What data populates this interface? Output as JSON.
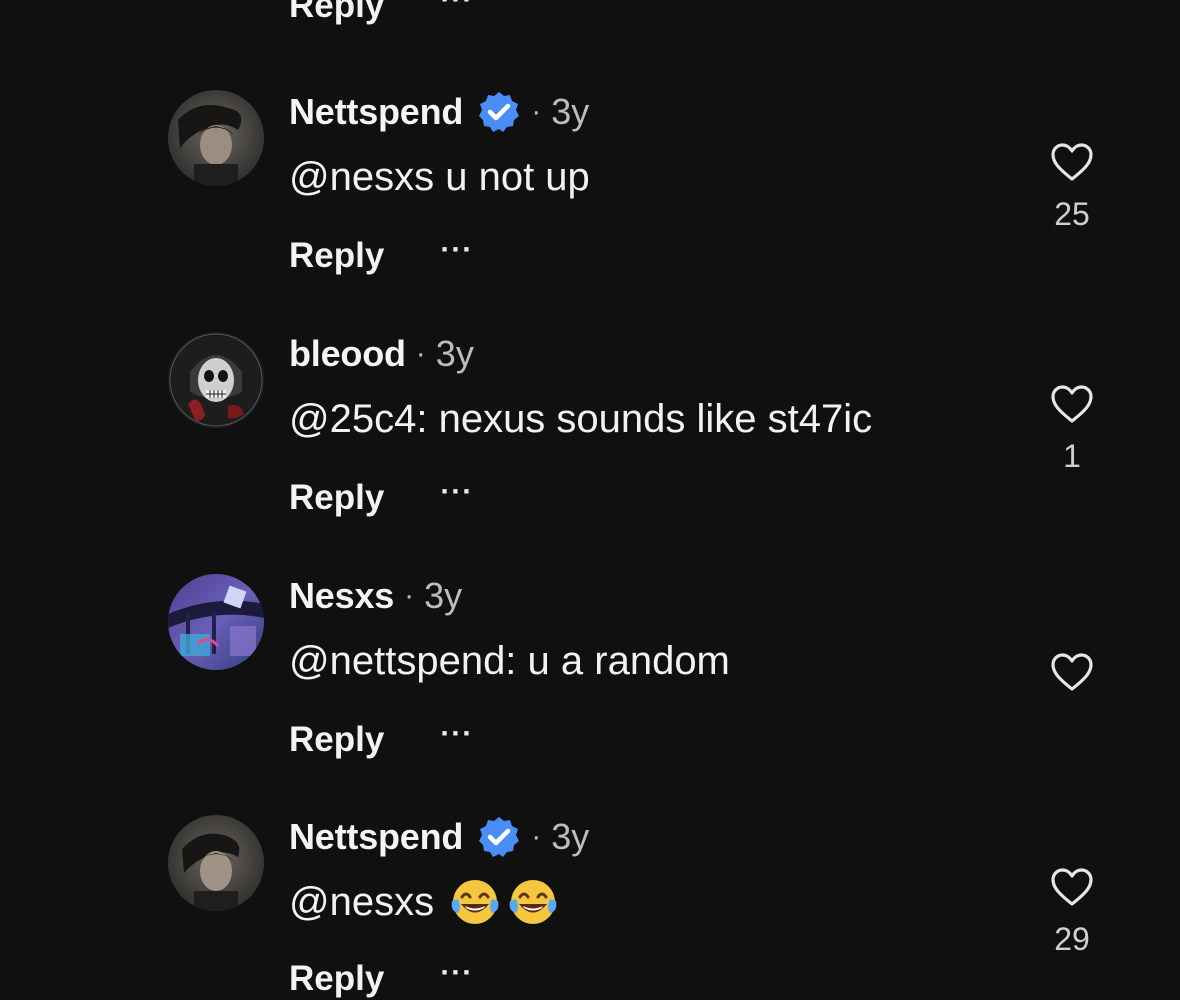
{
  "top_partial": {
    "reply_label": "Reply",
    "more_label": "···"
  },
  "comments": [
    {
      "username": "Nettspend",
      "verified": true,
      "separator": "·",
      "time": "3y",
      "text": "@nesxs u not up",
      "reply_label": "Reply",
      "more_label": "···",
      "likes": "25",
      "avatar": "dark-portrait-avatar"
    },
    {
      "username": "bleood",
      "verified": false,
      "separator": "·",
      "time": "3y",
      "text": "@25c4: nexus sounds like st47ic",
      "reply_label": "Reply",
      "more_label": "···",
      "likes": "1",
      "avatar": "skull-avatar"
    },
    {
      "username": "Nesxs",
      "verified": false,
      "separator": "·",
      "time": "3y",
      "text": "@nettspend: u a random",
      "reply_label": "Reply",
      "more_label": "···",
      "likes": "",
      "avatar": "purple-scene-avatar"
    },
    {
      "username": "Nettspend",
      "verified": true,
      "separator": "·",
      "time": "3y",
      "text": "@nesxs",
      "emojis": [
        "face-with-tears-of-joy",
        "face-with-tears-of-joy"
      ],
      "reply_label": "Reply",
      "more_label": "···",
      "likes": "29",
      "avatar": "dark-portrait-avatar"
    }
  ],
  "colors": {
    "background": "#101011",
    "verified_blue": "#4a8df7",
    "text_primary": "#f2f2f2",
    "text_secondary": "#bdbdbd"
  }
}
